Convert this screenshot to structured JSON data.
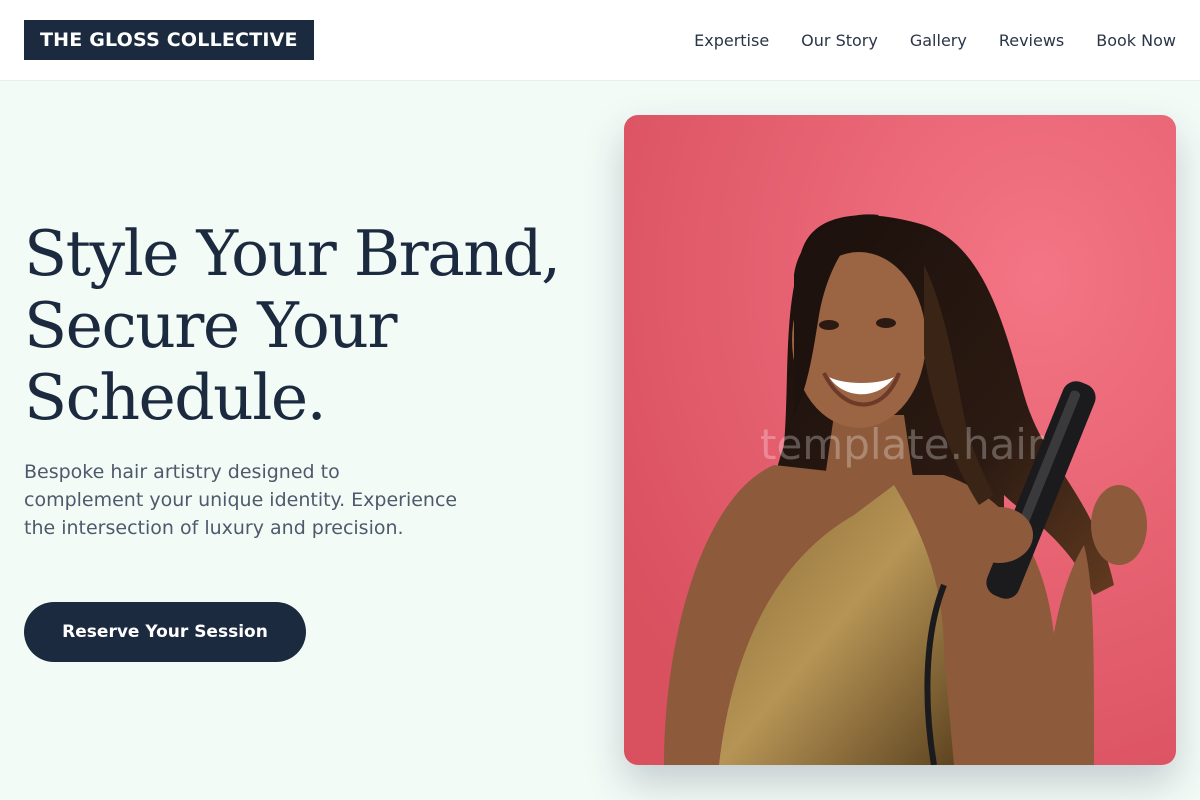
{
  "brand": {
    "name": "THE GLOSS COLLECTIVE"
  },
  "nav": {
    "items": [
      {
        "label": "Expertise"
      },
      {
        "label": "Our Story"
      },
      {
        "label": "Gallery"
      },
      {
        "label": "Reviews"
      },
      {
        "label": "Book Now"
      }
    ]
  },
  "hero": {
    "title_lines": [
      "Style Your Brand,",
      "Secure Your",
      "Schedule."
    ],
    "subtitle": "Bespoke hair artistry designed to complement your unique identity. Experience the intersection of luxury and precision.",
    "cta_label": "Reserve Your Session",
    "image_watermark": "template.hair"
  },
  "colors": {
    "navy": "#1c2a3f",
    "page_bg": "#f3fbf7",
    "photo_bg": "#e95f72"
  }
}
